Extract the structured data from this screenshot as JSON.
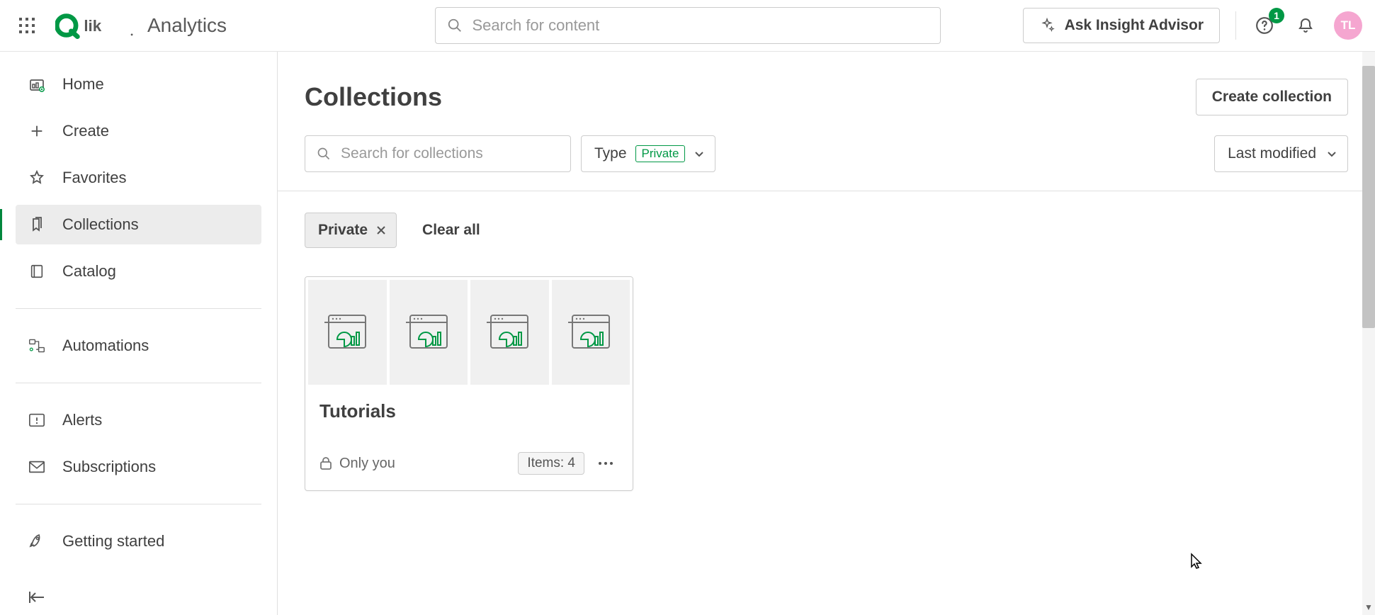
{
  "topbar": {
    "product": "Analytics",
    "search_placeholder": "Search for content",
    "ask_button": "Ask Insight Advisor",
    "notification_count": "1",
    "avatar_initials": "TL"
  },
  "sidebar": {
    "items": [
      {
        "label": "Home"
      },
      {
        "label": "Create"
      },
      {
        "label": "Favorites"
      },
      {
        "label": "Collections"
      },
      {
        "label": "Catalog"
      },
      {
        "label": "Automations"
      },
      {
        "label": "Alerts"
      },
      {
        "label": "Subscriptions"
      },
      {
        "label": "Getting started"
      }
    ]
  },
  "page": {
    "title": "Collections",
    "create_button": "Create collection",
    "search_placeholder": "Search for collections",
    "type_label": "Type",
    "type_value": "Private",
    "sort_label": "Last modified",
    "filter_chip": "Private",
    "clear_all": "Clear all"
  },
  "card": {
    "title": "Tutorials",
    "visibility": "Only you",
    "items_label": "Items: 4"
  }
}
